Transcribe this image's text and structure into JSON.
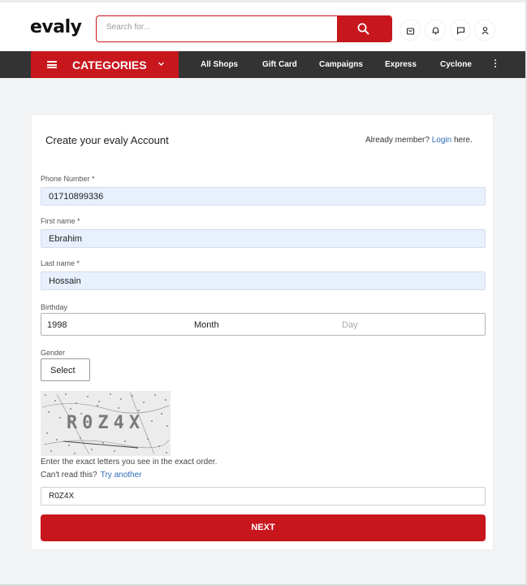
{
  "header": {
    "logo": "evaly",
    "search_placeholder": "Search for...",
    "icons": [
      "shopping-bag-icon",
      "bell-icon",
      "chat-icon",
      "user-icon"
    ]
  },
  "nav": {
    "categories_label": "CATEGORIES",
    "items": [
      "All Shops",
      "Gift Card",
      "Campaigns",
      "Express",
      "Cyclone"
    ]
  },
  "form": {
    "title": "Create your evaly Account",
    "already_text": "Already member?",
    "login_link": "Login",
    "here_text": " here.",
    "phone_label": "Phone Number *",
    "phone_value": "01710899336",
    "first_label": "First name *",
    "first_value": "Ebrahim",
    "last_label": "Last name *",
    "last_value": "Hossain",
    "birthday_label": "Birthday",
    "birthday_year": "1998",
    "birthday_month": "Month",
    "birthday_day": "Day",
    "gender_label": "Gender",
    "gender_value": "Select",
    "captcha_text": "R0Z4X",
    "captcha_hint": "Enter the exact letters you see in the exact order.",
    "cant_read": "Can't read this?",
    "try_another": "Try another",
    "captcha_value": "R0Z4X",
    "next_label": "NEXT"
  },
  "colors": {
    "brand_red": "#c8161d",
    "nav_dark": "#333334",
    "link_blue": "#2f6bb3",
    "autofill_blue": "#e8f0fe"
  }
}
